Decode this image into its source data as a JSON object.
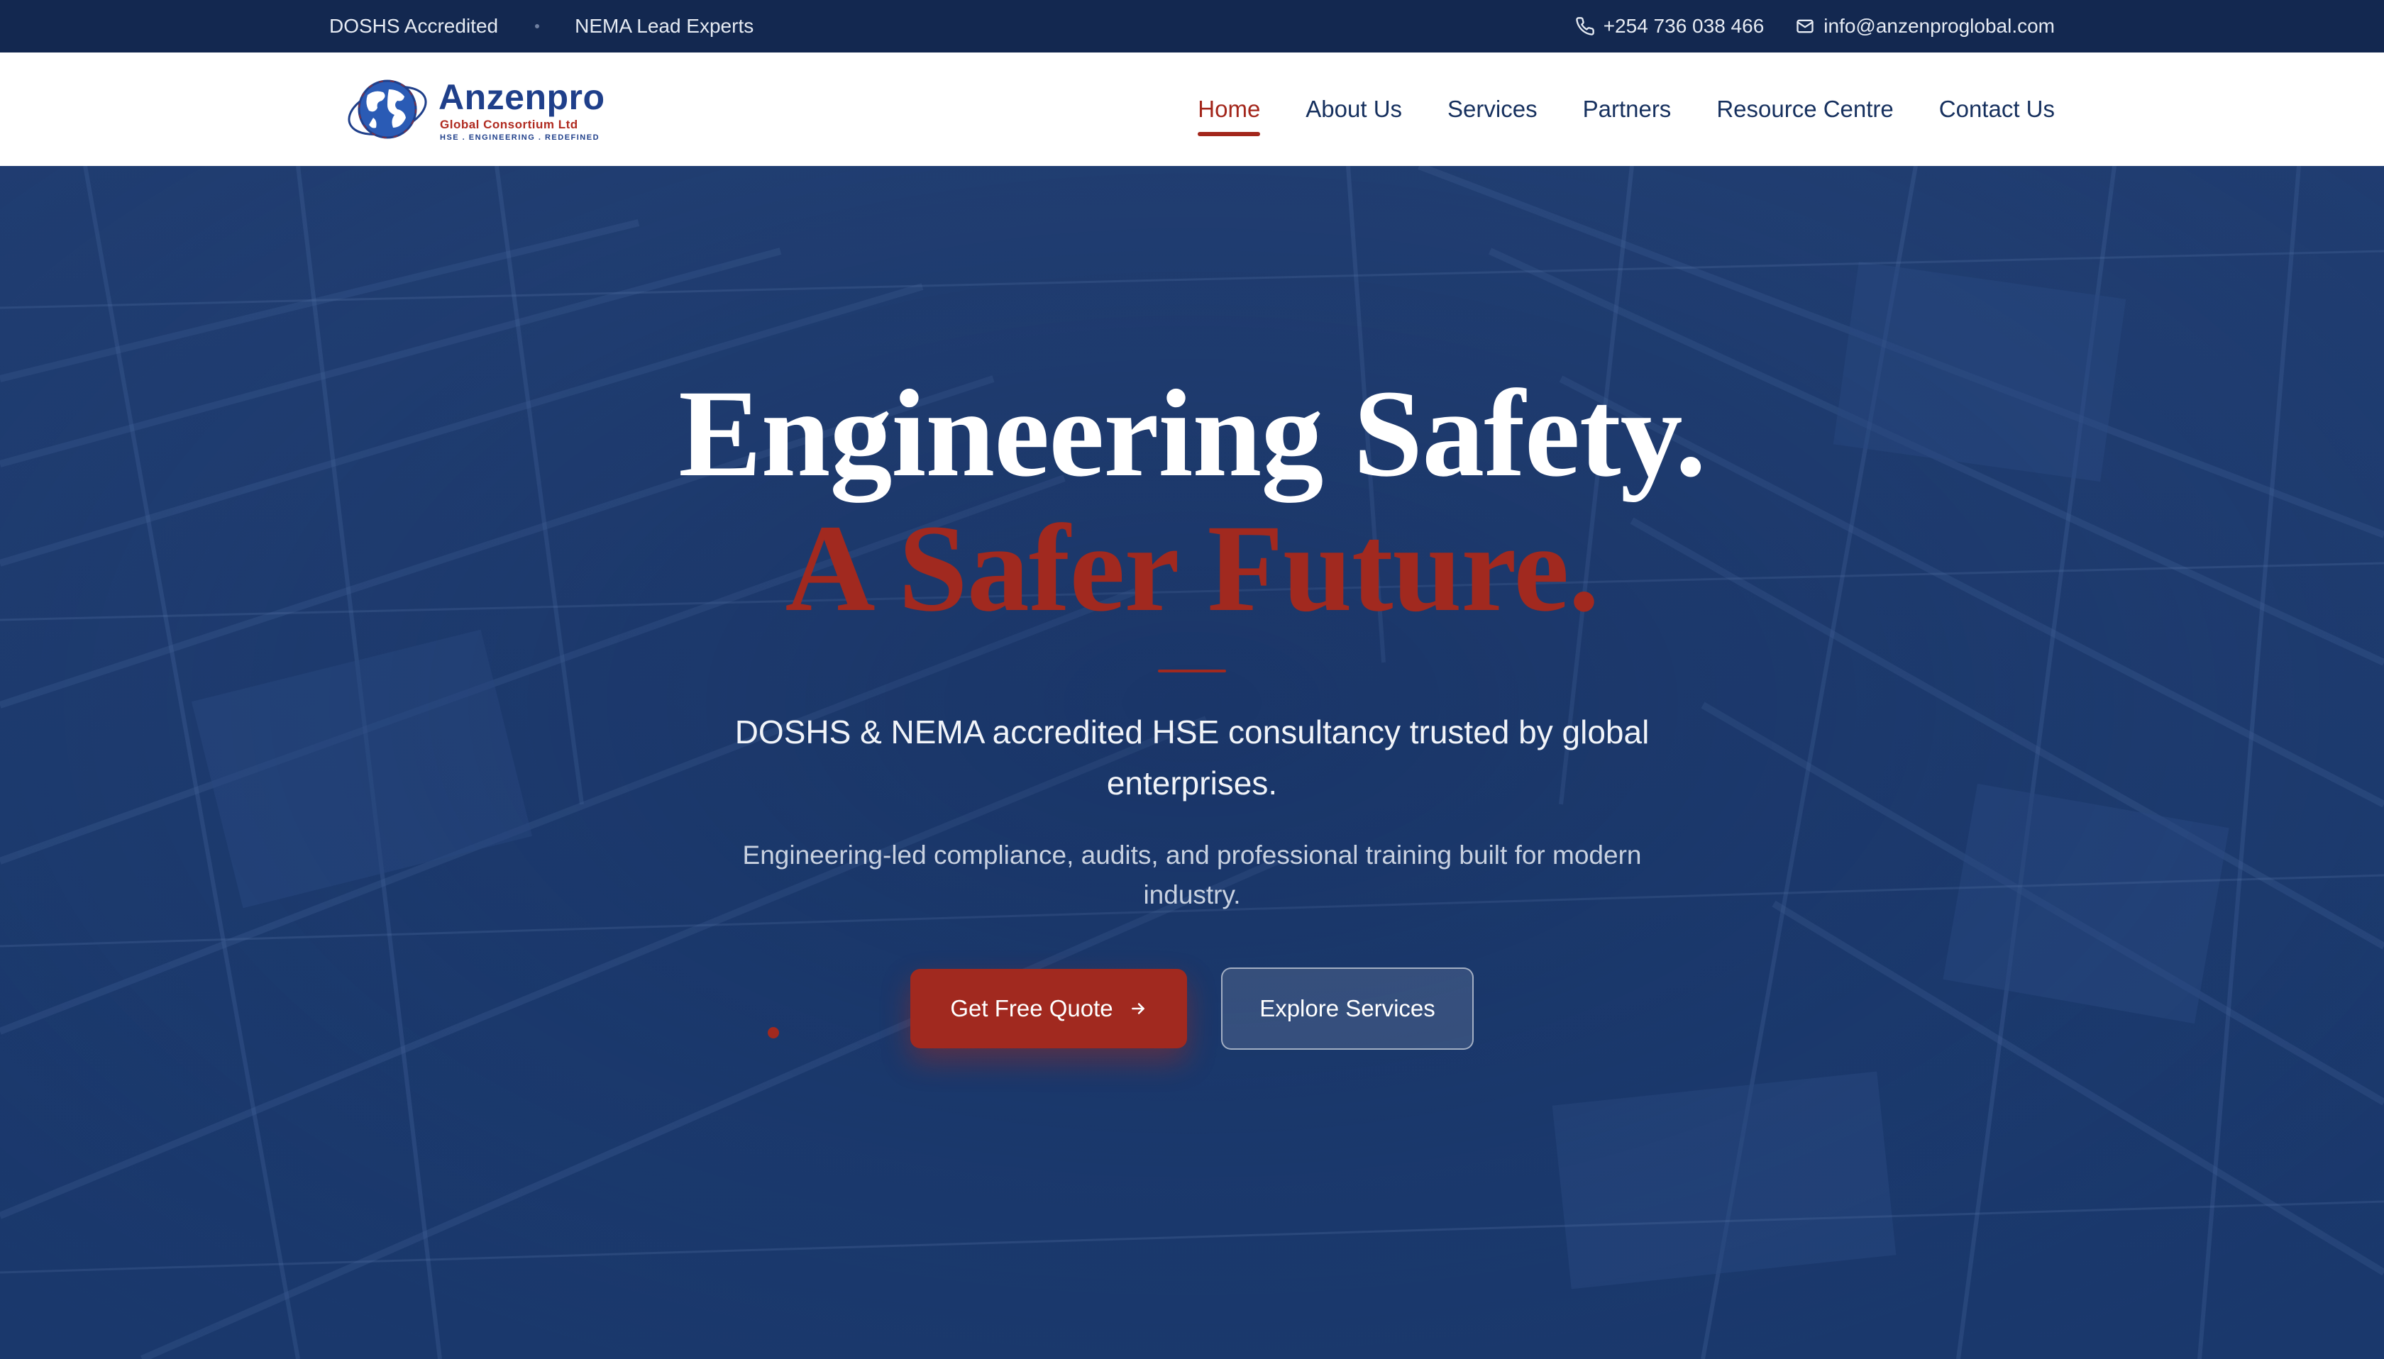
{
  "topbar": {
    "badge1": "DOSHS Accredited",
    "badge2": "NEMA Lead Experts",
    "phone": "+254 736 038 466",
    "email": "info@anzenproglobal.com"
  },
  "brand": {
    "name": "Anzenpro",
    "subtitle": "Global Consortium Ltd",
    "tagline": "HSE . ENGINEERING . REDEFINED"
  },
  "nav": {
    "items": [
      {
        "label": "Home",
        "active": true
      },
      {
        "label": "About Us"
      },
      {
        "label": "Services"
      },
      {
        "label": "Partners"
      },
      {
        "label": "Resource Centre"
      },
      {
        "label": "Contact Us"
      }
    ]
  },
  "hero": {
    "title_line1": "Engineering Safety.",
    "title_line2": "A Safer Future.",
    "lead": "DOSHS & NEMA accredited HSE consultancy trusted by global enterprises.",
    "sub": "Engineering-led compliance, audits, and professional training built for modern industry.",
    "cta_primary": "Get Free Quote",
    "cta_secondary": "Explore Services"
  },
  "colors": {
    "accent": "#a1291f",
    "navy": "#132850",
    "hero_bg": "#1f3c6f"
  },
  "icons": [
    "phone-icon",
    "mail-icon",
    "globe-logo-icon",
    "arrow-right-icon"
  ]
}
